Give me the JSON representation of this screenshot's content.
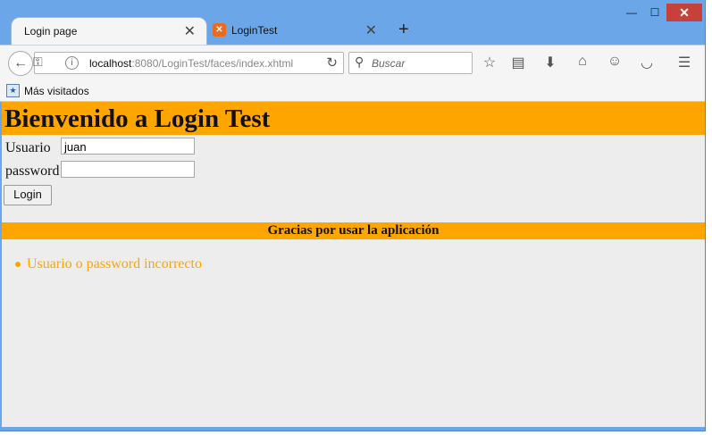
{
  "window": {
    "buttons": {
      "minimize": "—",
      "maximize": "☐",
      "close": "✕"
    }
  },
  "tabs": [
    {
      "label": "Login page",
      "active": true
    },
    {
      "label": "LoginTest",
      "active": false
    }
  ],
  "navbar": {
    "url_host": "localhost",
    "url_rest": ":8080/LoginTest/faces/index.xhtml",
    "search_placeholder": "Buscar"
  },
  "bookmarks": {
    "label": "Más visitados"
  },
  "page": {
    "header": "Bienvenido a Login Test",
    "username_label": "Usuario",
    "username_value": "juan",
    "password_label": "password",
    "password_value": "",
    "login_button": "Login",
    "footer": "Gracias por usar la aplicación",
    "messages": [
      "Usuario o password incorrecto"
    ]
  },
  "colors": {
    "accent": "#ffa500",
    "background": "#ededed"
  }
}
